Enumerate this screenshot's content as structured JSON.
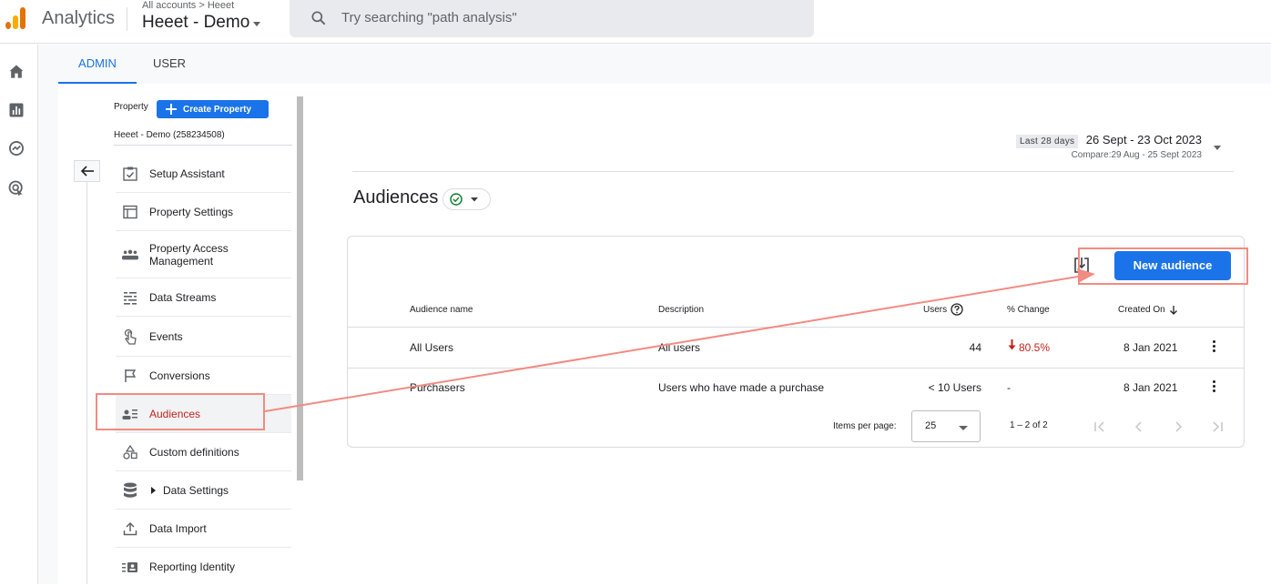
{
  "header": {
    "app_name": "Analytics",
    "account_path": "All accounts > Heeet",
    "property_name": "Heeet - Demo",
    "search_placeholder": "Try searching \"path analysis\""
  },
  "rail": {
    "items": [
      "home-icon",
      "reports-icon",
      "explore-icon",
      "advertising-icon"
    ]
  },
  "tabs": [
    {
      "label": "ADMIN",
      "active": true
    },
    {
      "label": "USER",
      "active": false
    }
  ],
  "admin": {
    "property_label": "Property",
    "create_property_label": "Create Property",
    "property_id": "Heeet - Demo (258234508)",
    "nav_items": [
      {
        "label": "Setup Assistant",
        "icon": "checklist-icon"
      },
      {
        "label": "Property Settings",
        "icon": "property-settings-icon"
      },
      {
        "label": "Property Access Management",
        "icon": "people-icon"
      },
      {
        "label": "Data Streams",
        "icon": "data-streams-icon"
      },
      {
        "label": "Events",
        "icon": "touch-icon"
      },
      {
        "label": "Conversions",
        "icon": "flag-icon"
      },
      {
        "label": "Audiences",
        "icon": "audience-icon",
        "active": true
      },
      {
        "label": "Custom definitions",
        "icon": "shapes-icon"
      },
      {
        "label": "Data Settings",
        "icon": "database-icon"
      },
      {
        "label": "Data Import",
        "icon": "upload-icon"
      },
      {
        "label": "Reporting Identity",
        "icon": "identity-icon"
      }
    ]
  },
  "date": {
    "badge": "Last 28 days",
    "range": "26 Sept - 23 Oct 2023",
    "compare": "Compare:29 Aug - 25 Sept 2023"
  },
  "page": {
    "title": "Audiences",
    "new_audience_label": "New audience"
  },
  "table": {
    "columns": [
      "Audience name",
      "Description",
      "Users",
      "% Change",
      "Created On"
    ],
    "rows": [
      {
        "name": "All Users",
        "description": "All users",
        "users": "44",
        "change": "80.5%",
        "change_direction": "down",
        "created": "8 Jan 2021"
      },
      {
        "name": "Purchasers",
        "description": "Users who have made a purchase",
        "users": "< 10 Users",
        "change": "-",
        "created": "8 Jan 2021"
      }
    ],
    "items_per_page_label": "Items per page:",
    "items_per_page": "25",
    "range": "1 – 2 of 2"
  },
  "colors": {
    "accent": "#1a73e8",
    "negative": "#c5221f",
    "annotation": "#f28b82",
    "logo_orange": "#f9ab00",
    "logo_dark_orange": "#e37400"
  }
}
